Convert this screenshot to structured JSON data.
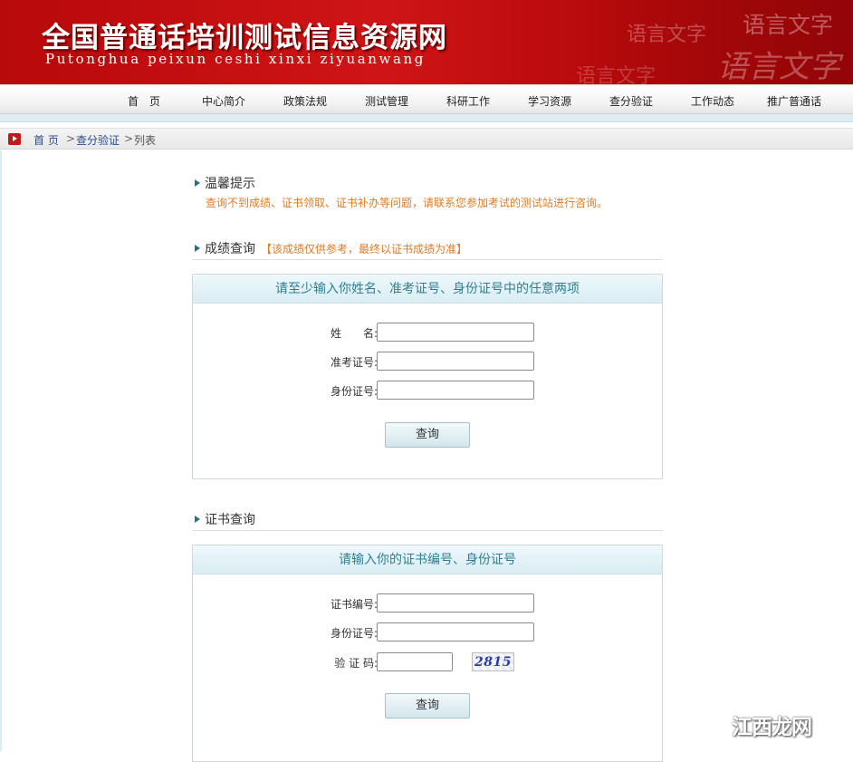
{
  "header": {
    "title": "全国普通话培训测试信息资源网",
    "subtitle": "Putonghua peixun ceshi xinxi ziyuanwang",
    "decorative_text": [
      "语言文字",
      "语言文字",
      "语言文字",
      "语言文字"
    ]
  },
  "nav": {
    "items": [
      "首　页",
      "中心简介",
      "政策法规",
      "测试管理",
      "科研工作",
      "学习资源",
      "查分验证",
      "工作动态",
      "推广普通话"
    ]
  },
  "breadcrumb": {
    "home": "首 页",
    "separator": ">",
    "section": "查分验证",
    "current": "列表"
  },
  "tips": {
    "title": "温馨提示",
    "text": "查询不到成绩、证书领取、证书补办等问题，请联系您参加考试的测试站进行咨询。"
  },
  "score_query": {
    "title": "成绩查询",
    "note": "【该成绩仅供参考，最终以证书成绩为准】",
    "panel_title": "请至少输入你姓名、准考证号、身份证号中的任意两项",
    "fields": {
      "name_label": "姓　　名:",
      "name_value": "",
      "exam_no_label": "准考证号:",
      "exam_no_value": "",
      "id_label": "身份证号:",
      "id_value": ""
    },
    "button": "查询"
  },
  "cert_query": {
    "title": "证书查询",
    "panel_title": "请输入你的证书编号、身份证号",
    "fields": {
      "cert_no_label": "证书编号:",
      "cert_no_value": "",
      "id_label": "身份证号:",
      "id_value": "",
      "captcha_label": "验 证 码:",
      "captcha_value": ""
    },
    "captcha_image_text": "2815",
    "button": "查询"
  },
  "watermark": {
    "text": "江西龙网"
  }
}
